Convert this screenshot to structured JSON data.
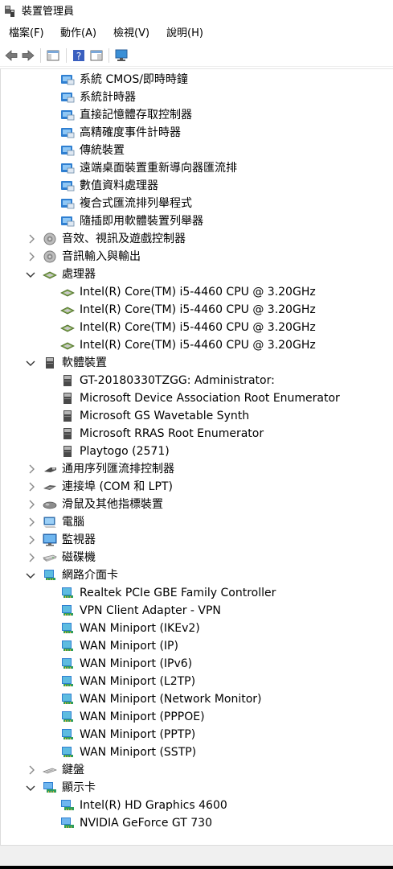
{
  "window": {
    "title": "裝置管理員"
  },
  "menu": [
    "檔案(F)",
    "動作(A)",
    "檢視(V)",
    "說明(H)"
  ],
  "toolbar": [
    {
      "name": "back-icon"
    },
    {
      "name": "forward-icon"
    },
    {
      "name": "show-hide-console-tree-icon"
    },
    {
      "name": "help-icon"
    },
    {
      "name": "properties-icon"
    },
    {
      "name": "scan-hardware-icon"
    }
  ],
  "tree": [
    {
      "label": "系統 CMOS/即時時鐘",
      "level": 2,
      "icon": "system-device"
    },
    {
      "label": "系統計時器",
      "level": 2,
      "icon": "system-device"
    },
    {
      "label": "直接記憶體存取控制器",
      "level": 2,
      "icon": "system-device"
    },
    {
      "label": "高精確度事件計時器",
      "level": 2,
      "icon": "system-device"
    },
    {
      "label": "傳統裝置",
      "level": 2,
      "icon": "system-device"
    },
    {
      "label": "遠端桌面裝置重新導向器匯流排",
      "level": 2,
      "icon": "system-device"
    },
    {
      "label": "數值資料處理器",
      "level": 2,
      "icon": "system-device"
    },
    {
      "label": "複合式匯流排列舉程式",
      "level": 2,
      "icon": "system-device"
    },
    {
      "label": "隨插即用軟體裝置列舉器",
      "level": 2,
      "icon": "system-device"
    },
    {
      "label": "音效、視訊及遊戲控制器",
      "level": 1,
      "icon": "speaker",
      "expander": "collapsed"
    },
    {
      "label": "音訊輸入與輸出",
      "level": 1,
      "icon": "speaker",
      "expander": "collapsed"
    },
    {
      "label": "處理器",
      "level": 1,
      "icon": "chip",
      "expander": "expanded"
    },
    {
      "label": "Intel(R) Core(TM) i5-4460  CPU @ 3.20GHz",
      "level": 2,
      "icon": "chip"
    },
    {
      "label": "Intel(R) Core(TM) i5-4460  CPU @ 3.20GHz",
      "level": 2,
      "icon": "chip"
    },
    {
      "label": "Intel(R) Core(TM) i5-4460  CPU @ 3.20GHz",
      "level": 2,
      "icon": "chip"
    },
    {
      "label": "Intel(R) Core(TM) i5-4460  CPU @ 3.20GHz",
      "level": 2,
      "icon": "chip"
    },
    {
      "label": "軟體裝置",
      "level": 1,
      "icon": "software-device",
      "expander": "expanded"
    },
    {
      "label": "GT-20180330TZGG: Administrator:",
      "level": 2,
      "icon": "software-device"
    },
    {
      "label": "Microsoft Device Association Root Enumerator",
      "level": 2,
      "icon": "software-device"
    },
    {
      "label": "Microsoft GS Wavetable Synth",
      "level": 2,
      "icon": "software-device"
    },
    {
      "label": "Microsoft RRAS Root Enumerator",
      "level": 2,
      "icon": "software-device"
    },
    {
      "label": "Playtogo (2571)",
      "level": 2,
      "icon": "software-device"
    },
    {
      "label": "通用序列匯流排控制器",
      "level": 1,
      "icon": "usb",
      "expander": "collapsed"
    },
    {
      "label": "連接埠 (COM 和 LPT)",
      "level": 1,
      "icon": "port",
      "expander": "collapsed"
    },
    {
      "label": "滑鼠及其他指標裝置",
      "level": 1,
      "icon": "mouse",
      "expander": "collapsed"
    },
    {
      "label": "電腦",
      "level": 1,
      "icon": "computer",
      "expander": "collapsed"
    },
    {
      "label": "監視器",
      "level": 1,
      "icon": "monitor",
      "expander": "collapsed"
    },
    {
      "label": "磁碟機",
      "level": 1,
      "icon": "disk",
      "expander": "collapsed"
    },
    {
      "label": "網路介面卡",
      "level": 1,
      "icon": "network",
      "expander": "expanded"
    },
    {
      "label": "Realtek PCIe GBE Family Controller",
      "level": 2,
      "icon": "network"
    },
    {
      "label": "VPN Client Adapter - VPN",
      "level": 2,
      "icon": "network"
    },
    {
      "label": "WAN Miniport (IKEv2)",
      "level": 2,
      "icon": "network"
    },
    {
      "label": "WAN Miniport (IP)",
      "level": 2,
      "icon": "network"
    },
    {
      "label": "WAN Miniport (IPv6)",
      "level": 2,
      "icon": "network"
    },
    {
      "label": "WAN Miniport (L2TP)",
      "level": 2,
      "icon": "network"
    },
    {
      "label": "WAN Miniport (Network Monitor)",
      "level": 2,
      "icon": "network"
    },
    {
      "label": "WAN Miniport (PPPOE)",
      "level": 2,
      "icon": "network"
    },
    {
      "label": "WAN Miniport (PPTP)",
      "level": 2,
      "icon": "network"
    },
    {
      "label": "WAN Miniport (SSTP)",
      "level": 2,
      "icon": "network"
    },
    {
      "label": "鍵盤",
      "level": 1,
      "icon": "keyboard",
      "expander": "collapsed"
    },
    {
      "label": "顯示卡",
      "level": 1,
      "icon": "display",
      "expander": "expanded"
    },
    {
      "label": "Intel(R) HD Graphics 4600",
      "level": 2,
      "icon": "display"
    },
    {
      "label": "NVIDIA GeForce GT 730",
      "level": 2,
      "icon": "display"
    }
  ]
}
